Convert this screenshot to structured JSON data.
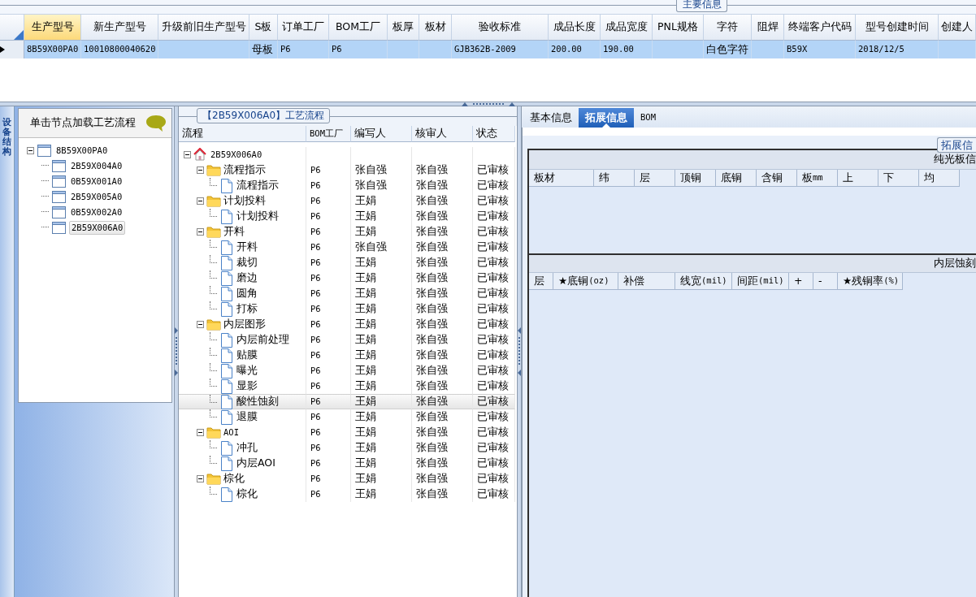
{
  "main_info": {
    "title": "主要信息",
    "table": {
      "columns": [
        "生产型号",
        "新生产型号",
        "升级前旧生产型号",
        "S板",
        "订单工厂",
        "BOM工厂",
        "板厚",
        "板材",
        "验收标准",
        "成品长度",
        "成品宽度",
        "PNL规格",
        "字符",
        "阻焊",
        "终端客户代码",
        "型号创建时间",
        "创建人"
      ],
      "rows": [
        {
          "selected": true,
          "cells": [
            "8B59X00PA0",
            "10010800040620",
            null,
            "母板",
            "P6",
            "P6",
            null,
            null,
            "GJB362B-2009",
            "200.00",
            "190.00",
            null,
            "白色字符",
            null,
            "B59X",
            "2018/12/5",
            null
          ]
        }
      ]
    }
  },
  "side_tab": {
    "label": "设备结构"
  },
  "structure_panel": {
    "header": "单击节点加载工艺流程",
    "tree": [
      {
        "label": "8B59X00PA0",
        "expanded": true,
        "selected": false,
        "children": [
          {
            "label": "2B59X004A0",
            "selected": false
          },
          {
            "label": "0B59X001A0",
            "selected": false
          },
          {
            "label": "2B59X005A0",
            "selected": false
          },
          {
            "label": "0B59X002A0",
            "selected": false
          },
          {
            "label": "2B59X006A0",
            "selected": true
          }
        ]
      }
    ]
  },
  "process_panel": {
    "title": "【2B59X006A0】工艺流程",
    "columns": [
      "流程",
      "BOM工厂",
      "编写人",
      "核审人",
      "状态"
    ],
    "tree": [
      {
        "kind": "home",
        "label": "2B59X006A0",
        "expanded": true,
        "selected": false,
        "children": [
          {
            "kind": "folder",
            "label": "流程指示",
            "expanded": true,
            "selected": false,
            "cells": [
              "P6",
              "张自强",
              "张自强",
              "已审核"
            ],
            "children": [
              {
                "kind": "document",
                "label": "流程指示",
                "selected": false,
                "cells": [
                  "P6",
                  "张自强",
                  "张自强",
                  "已审核"
                ]
              }
            ]
          },
          {
            "kind": "folder",
            "label": "计划投料",
            "expanded": true,
            "selected": false,
            "cells": [
              "P6",
              "王娟",
              "张自强",
              "已审核"
            ],
            "children": [
              {
                "kind": "document",
                "label": "计划投料",
                "selected": false,
                "cells": [
                  "P6",
                  "王娟",
                  "张自强",
                  "已审核"
                ]
              }
            ]
          },
          {
            "kind": "folder",
            "label": "开料",
            "expanded": true,
            "selected": false,
            "cells": [
              "P6",
              "王娟",
              "张自强",
              "已审核"
            ],
            "children": [
              {
                "kind": "document",
                "label": "开料",
                "selected": false,
                "cells": [
                  "P6",
                  "张自强",
                  "张自强",
                  "已审核"
                ]
              },
              {
                "kind": "document",
                "label": "裁切",
                "selected": false,
                "cells": [
                  "P6",
                  "王娟",
                  "张自强",
                  "已审核"
                ]
              },
              {
                "kind": "document",
                "label": "磨边",
                "selected": false,
                "cells": [
                  "P6",
                  "王娟",
                  "张自强",
                  "已审核"
                ]
              },
              {
                "kind": "document",
                "label": "圆角",
                "selected": false,
                "cells": [
                  "P6",
                  "王娟",
                  "张自强",
                  "已审核"
                ]
              },
              {
                "kind": "document",
                "label": "打标",
                "selected": false,
                "cells": [
                  "P6",
                  "王娟",
                  "张自强",
                  "已审核"
                ]
              }
            ]
          },
          {
            "kind": "folder",
            "label": "内层图形",
            "expanded": true,
            "selected": false,
            "cells": [
              "P6",
              "王娟",
              "张自强",
              "已审核"
            ],
            "children": [
              {
                "kind": "document",
                "label": "内层前处理",
                "selected": false,
                "cells": [
                  "P6",
                  "王娟",
                  "张自强",
                  "已审核"
                ]
              },
              {
                "kind": "document",
                "label": "贴膜",
                "selected": false,
                "cells": [
                  "P6",
                  "王娟",
                  "张自强",
                  "已审核"
                ]
              },
              {
                "kind": "document",
                "label": "曝光",
                "selected": false,
                "cells": [
                  "P6",
                  "王娟",
                  "张自强",
                  "已审核"
                ]
              },
              {
                "kind": "document",
                "label": "显影",
                "selected": false,
                "cells": [
                  "P6",
                  "王娟",
                  "张自强",
                  "已审核"
                ]
              },
              {
                "kind": "document",
                "label": "酸性蚀刻",
                "selected": true,
                "cells": [
                  "P6",
                  "王娟",
                  "张自强",
                  "已审核"
                ]
              },
              {
                "kind": "document",
                "label": "退膜",
                "selected": false,
                "cells": [
                  "P6",
                  "王娟",
                  "张自强",
                  "已审核"
                ]
              }
            ]
          },
          {
            "kind": "folder",
            "label": "AOI",
            "expanded": true,
            "selected": false,
            "cells": [
              "P6",
              "王娟",
              "张自强",
              "已审核"
            ],
            "children": [
              {
                "kind": "document",
                "label": "冲孔",
                "selected": false,
                "cells": [
                  "P6",
                  "王娟",
                  "张自强",
                  "已审核"
                ]
              },
              {
                "kind": "document",
                "label": "内层AOI",
                "selected": false,
                "cells": [
                  "P6",
                  "王娟",
                  "张自强",
                  "已审核"
                ]
              }
            ]
          },
          {
            "kind": "folder",
            "label": "棕化",
            "expanded": true,
            "selected": false,
            "cells": [
              "P6",
              "王娟",
              "张自强",
              "已审核"
            ],
            "children": [
              {
                "kind": "document",
                "label": "棕化",
                "selected": false,
                "cells": [
                  "P6",
                  "王娟",
                  "张自强",
                  "已审核"
                ]
              }
            ]
          }
        ]
      }
    ]
  },
  "detail_panel": {
    "tabs": [
      {
        "label": "基本信息",
        "selected": false
      },
      {
        "label": "拓展信息",
        "selected": true
      },
      {
        "label": "BOM",
        "selected": false
      }
    ],
    "group_title": "拓展信",
    "sections": [
      {
        "title": "纯光板信",
        "columns": [
          "板材",
          "纬",
          "层",
          "顶铜",
          "底铜",
          "含铜",
          "板mm",
          "上",
          "下",
          "均"
        ]
      },
      {
        "title": "内层蚀刻",
        "columns": [
          "层",
          "★底铜(oz)",
          "补偿",
          "线宽(mil)",
          "间距(mil)",
          "+",
          "-",
          "★残铜率(%)"
        ]
      }
    ]
  }
}
